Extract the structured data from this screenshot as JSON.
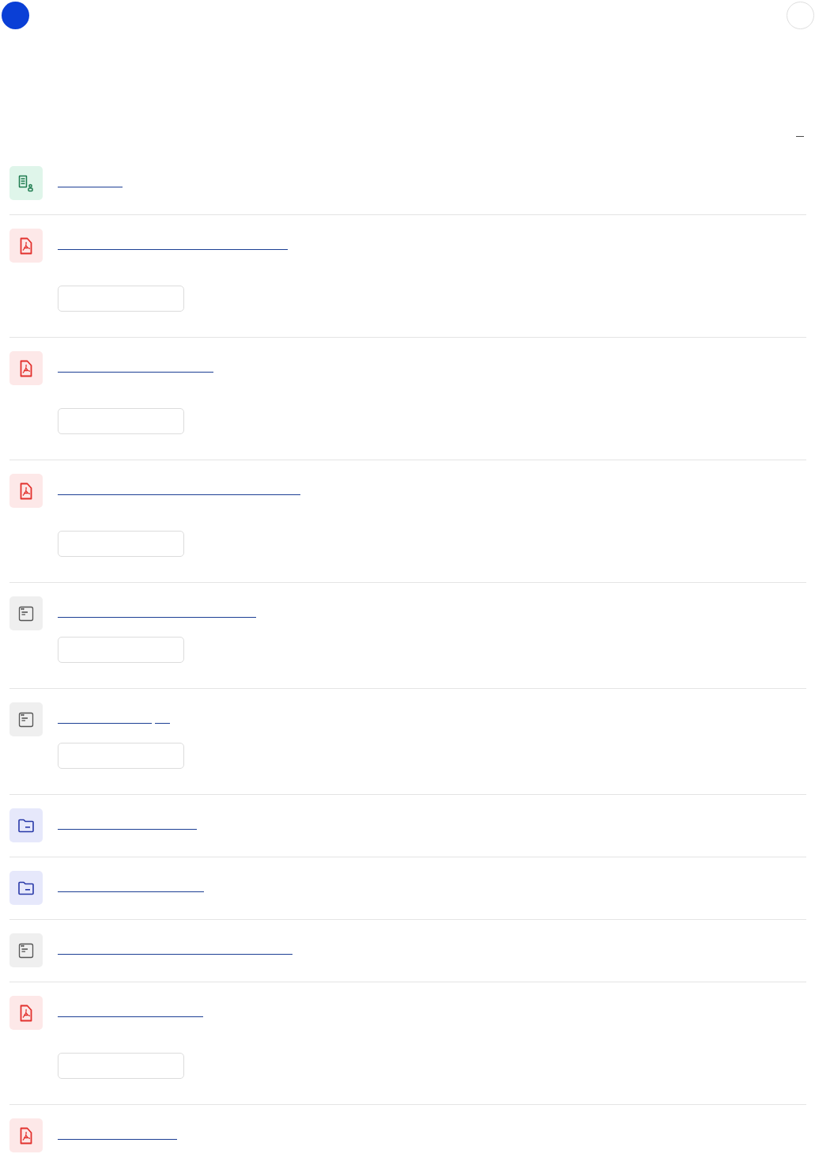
{
  "items": [
    {
      "kind": "document",
      "button": false
    },
    {
      "kind": "pdf",
      "button": true
    },
    {
      "kind": "pdf",
      "button": true
    },
    {
      "kind": "pdf",
      "button": true
    },
    {
      "kind": "page",
      "button": true
    },
    {
      "kind": "page",
      "button": true
    },
    {
      "kind": "folder",
      "button": false
    },
    {
      "kind": "folder",
      "button": false
    },
    {
      "kind": "page",
      "button": false
    },
    {
      "kind": "pdf",
      "button": true
    },
    {
      "kind": "pdf",
      "button": false
    }
  ]
}
